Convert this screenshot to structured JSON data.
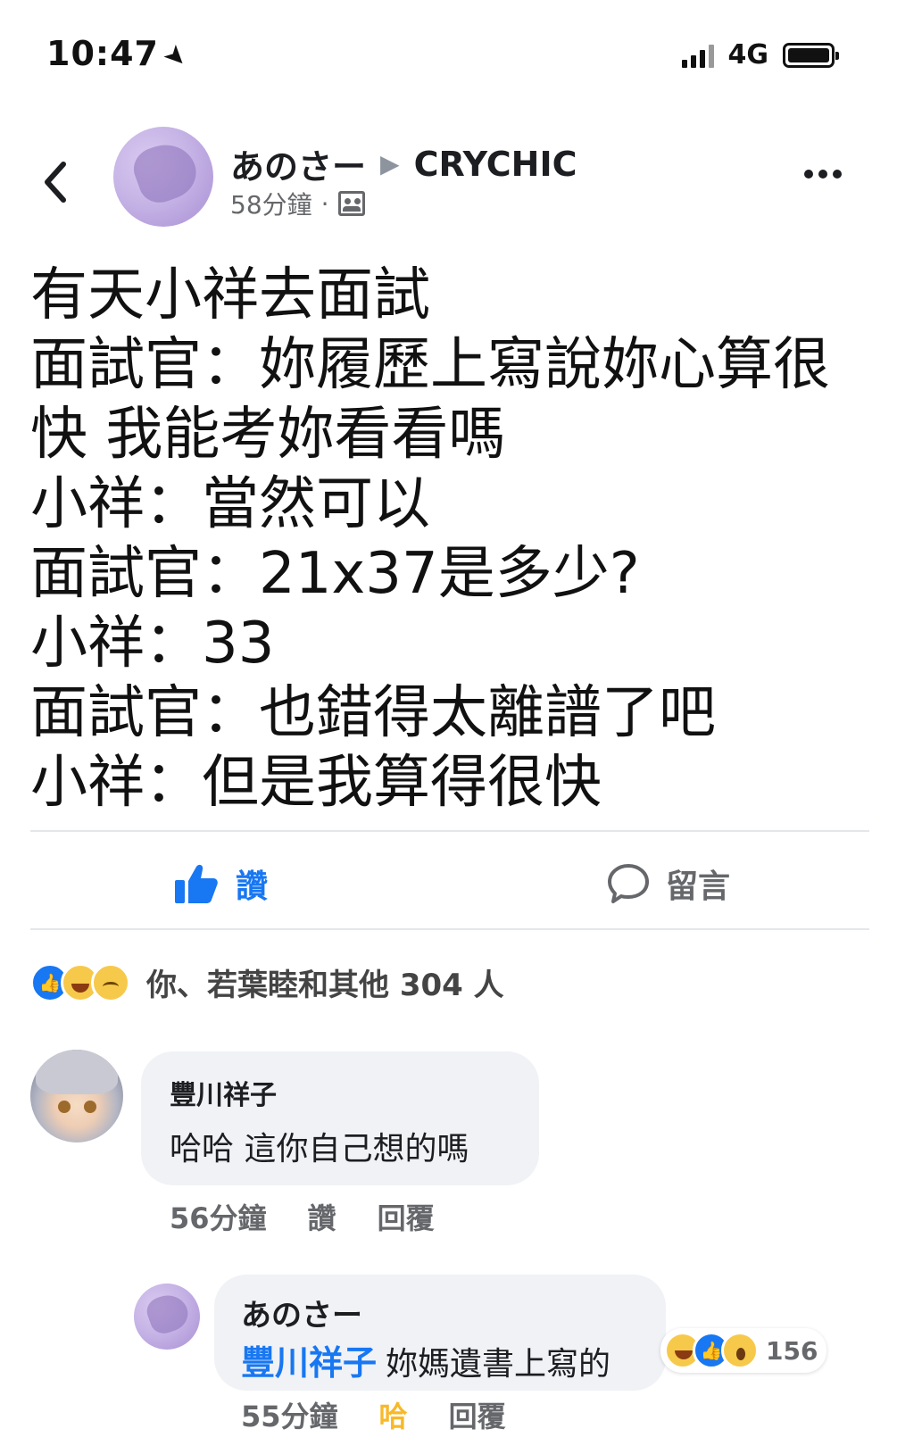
{
  "status_bar": {
    "time": "10:47",
    "location_icon": "location-arrow-icon",
    "network": "4G",
    "signal_icon": "cellular-signal-icon",
    "battery_icon": "battery-icon"
  },
  "post": {
    "author": "あのさー",
    "group_arrow": "▶",
    "group": "CRYCHIC",
    "time": "58分鐘",
    "separator": "·",
    "audience_icon": "group-audience-icon",
    "body_lines": [
      "有天小祥去面試",
      "面試官：妳履歷上寫說妳心算很",
      "快 我能考妳看看嗎",
      "小祥：當然可以",
      "面試官：21x37是多少?",
      "小祥：33",
      "面試官：也錯得太離譜了吧",
      "小祥：但是我算得很快"
    ]
  },
  "actions": {
    "like_label": "讚",
    "comment_label": "留言",
    "like_color": "#1877f2"
  },
  "reactions": {
    "icons": [
      "like-reaction-icon",
      "haha-reaction-icon",
      "sad-reaction-icon"
    ],
    "summary": "你、若葉睦和其他 304 人"
  },
  "comments": [
    {
      "author": "豐川祥子",
      "text": "哈哈 這你自己想的嗎",
      "time": "56分鐘",
      "like_label": "讚",
      "reply_label": "回覆"
    },
    {
      "author": "あのさー",
      "mention": "豐川祥子",
      "text": "妳媽遺書上寫的",
      "reaction_icons": [
        "haha-reaction-icon",
        "like-reaction-icon",
        "wow-reaction-icon"
      ],
      "reaction_count": "156",
      "time": "55分鐘",
      "like_label": "哈",
      "reply_label": "回覆"
    }
  ]
}
